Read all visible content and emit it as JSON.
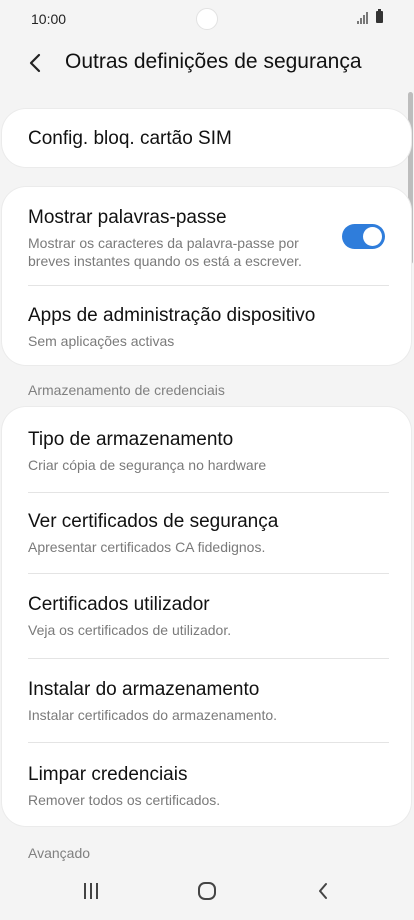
{
  "status_bar": {
    "time": "10:00"
  },
  "header": {
    "title": "Outras definições de segurança"
  },
  "sim_lock": {
    "title": "Config. bloq. cartão SIM"
  },
  "show_passwords": {
    "title": "Mostrar palavras-passe",
    "subtitle": "Mostrar os caracteres da palavra-passe por breves instantes quando os está a escrever.",
    "enabled": true
  },
  "device_admin": {
    "title": "Apps de administração dispositivo",
    "subtitle": "Sem aplicações activas"
  },
  "credential_storage": {
    "header": "Armazenamento de credenciais",
    "items": [
      {
        "title": "Tipo de armazenamento",
        "subtitle": "Criar cópia de segurança no hardware"
      },
      {
        "title": "Ver certificados de segurança",
        "subtitle": "Apresentar certificados CA fidedignos."
      },
      {
        "title": "Certificados utilizador",
        "subtitle": "Veja os certificados de utilizador."
      },
      {
        "title": "Instalar do armazenamento",
        "subtitle": "Instalar certificados do armazenamento."
      },
      {
        "title": "Limpar credenciais",
        "subtitle": "Remover todos os certificados."
      }
    ]
  },
  "advanced": {
    "header": "Avançado"
  },
  "colors": {
    "accent": "#2f7ddb",
    "background": "#f4f4f4",
    "card": "#ffffff"
  },
  "icons": [
    "back-arrow-icon",
    "signal-icon",
    "battery-icon",
    "recents-icon",
    "home-icon",
    "nav-back-icon"
  ]
}
